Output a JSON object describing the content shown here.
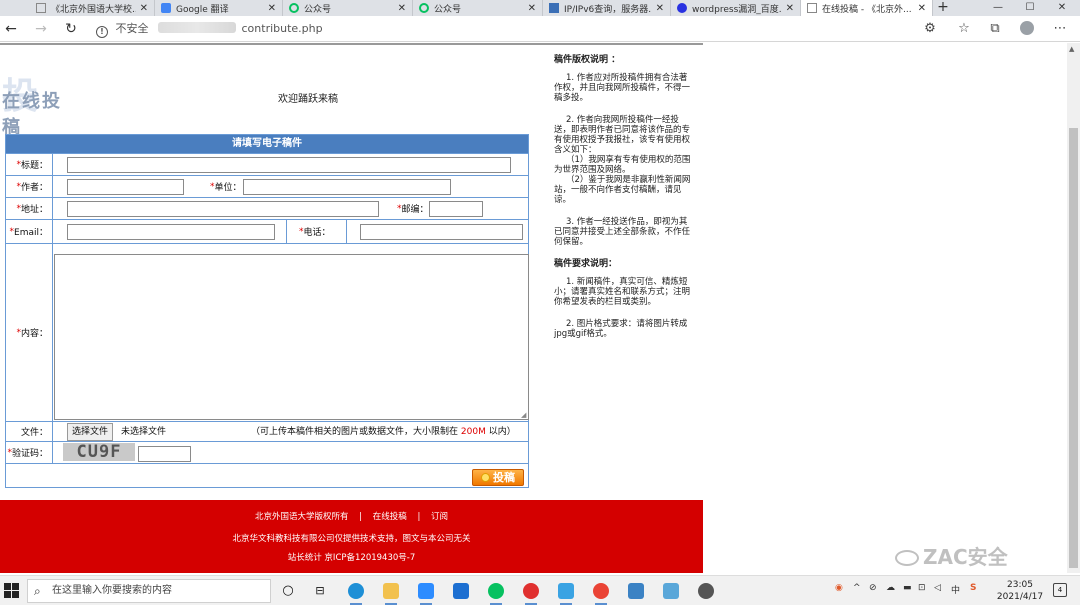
{
  "browser": {
    "tabs": [
      {
        "title": "《北京外国语大学校...",
        "icon": "doc-icon",
        "color": "#888888"
      },
      {
        "title": "Google 翻译",
        "icon": "google-translate-icon",
        "color": "#4285f4"
      },
      {
        "title": "公众号",
        "icon": "wechat-icon",
        "color": "#07c160"
      },
      {
        "title": "公众号",
        "icon": "wechat-icon",
        "color": "#07c160"
      },
      {
        "title": "IP/IPv6查询，服务器...",
        "icon": "ip-icon",
        "color": "#3b6fb6"
      },
      {
        "title": "wordpress漏洞_百度...",
        "icon": "baidu-icon",
        "color": "#2932e1"
      },
      {
        "title": "在线投稿 - 《北京外...",
        "icon": "doc-icon",
        "color": "#888888"
      }
    ],
    "window_controls": {
      "minimize": "—",
      "maximize": "☐",
      "close": "✕"
    },
    "address": {
      "insecure_label": "不安全",
      "url_tail": "contribute.php"
    }
  },
  "page": {
    "logo_char": "投",
    "logo_text": "在线投稿",
    "welcome": "欢迎踊跃来稿",
    "form": {
      "header": "请填写电子稿件",
      "required_mark": "*",
      "title_label": "标题：",
      "author_label": "作者：",
      "unit_label": "单位：",
      "address_label": "地址：",
      "postcode_label": "邮编：",
      "email_label": "Email：",
      "phone_label": "电话：",
      "content_label": "内容：",
      "file_label": "文件：",
      "file_button": "选择文件",
      "file_none": "未选择文件",
      "file_note_pre": "（可上传本稿件相关的图片或数据文件，大小限制在",
      "file_note_size": "200M",
      "file_note_post": "以内）",
      "captcha_label": "验证码：",
      "captcha_text": "CU9F",
      "submit_label": "投稿"
    },
    "sidebar": {
      "copyright_heading": "稿件版权说明 ：",
      "copyright_p1": "1. 作者应对所投稿件拥有合法著作权，并且向我网所投稿件，不得一稿多投。",
      "copyright_p2": "2. 作者向我网所投稿件一经投送，即表明作者已同意将该作品的专有使用权授予我报社，该专有使用权含义如下：",
      "copyright_p2a": "（1）我网享有专有使用权的范围为世界范围及网络。",
      "copyright_p2b": "（2）鉴于我网是非赢利性新闻网站，一般不向作者支付稿酬，请见谅。",
      "copyright_p3": "3. 作者一经投送作品，即视为其已同意并接受上述全部条款，不作任何保留。",
      "req_heading": "稿件要求说明：",
      "req_p1": "1. 新闻稿件，真实可信、精炼短小；请署真实姓名和联系方式；注明你希望发表的栏目或类别。",
      "req_p2": "2. 图片格式要求：请将图片转成jpg或gif格式。"
    },
    "footer": {
      "link_copyright": "北京外国语大学版权所有",
      "link_submit": "在线投稿",
      "link_subscribe": "订阅",
      "separator": "|",
      "line2": "北京华文科教科技有限公司仅提供技术支持，图文与本公司无关",
      "line3": "站长统计  京ICP备12019430号-7"
    }
  },
  "watermark": "ZAC安全",
  "taskbar": {
    "search_placeholder": "在这里输入你要搜索的内容",
    "tray_lang": "中",
    "time": "23:05",
    "date": "2021/4/17",
    "notif_count": "4"
  }
}
